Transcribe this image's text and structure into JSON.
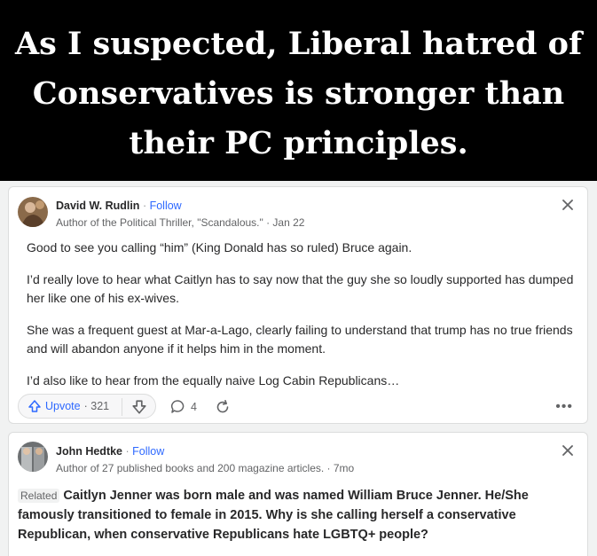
{
  "banner": {
    "lines": [
      "As I suspected, Liberal hatred of",
      "Conservatives is stronger than",
      "their PC principles."
    ]
  },
  "answer1": {
    "author": "David W. Rudlin",
    "separator": "·",
    "follow_label": "Follow",
    "credential": "Author of the Political Thriller, \"Scandalous.\" · Jan 22",
    "paragraphs": [
      "Good to see you calling “him” (King Donald has so ruled) Bruce again.",
      "I’d really love to hear what Caitlyn has to say now that the guy she so loudly supported has dumped her like one of his ex-wives.",
      "She was a frequent guest at Mar-a-Lago, clearly failing to understand that trump has no true friends and will abandon anyone if it helps him in the moment.",
      "I’d also like to hear from the equally naive Log Cabin Republicans…"
    ],
    "upvote_label": "Upvote",
    "upvote_count": "· 321",
    "comment_count": "4",
    "more_label": "•••"
  },
  "answer2": {
    "author": "John Hedtke",
    "separator": "·",
    "follow_label": "Follow",
    "credential": "Author of 27 published books and 200 magazine articles. · 7mo",
    "related_tag": "Related",
    "related_question": "Caitlyn Jenner was born male and was named William Bruce Jenner. He/She famously transitioned to female in 2015. Why is she calling herself a conservative Republican, when conservative Republicans hate LGBTQ+ people?"
  },
  "colors": {
    "link": "#2e69ff",
    "text": "#282829",
    "muted": "#636466"
  },
  "icons": [
    "close-icon",
    "upvote-arrow-icon",
    "downvote-arrow-icon",
    "comment-icon",
    "share-icon",
    "more-icon"
  ]
}
